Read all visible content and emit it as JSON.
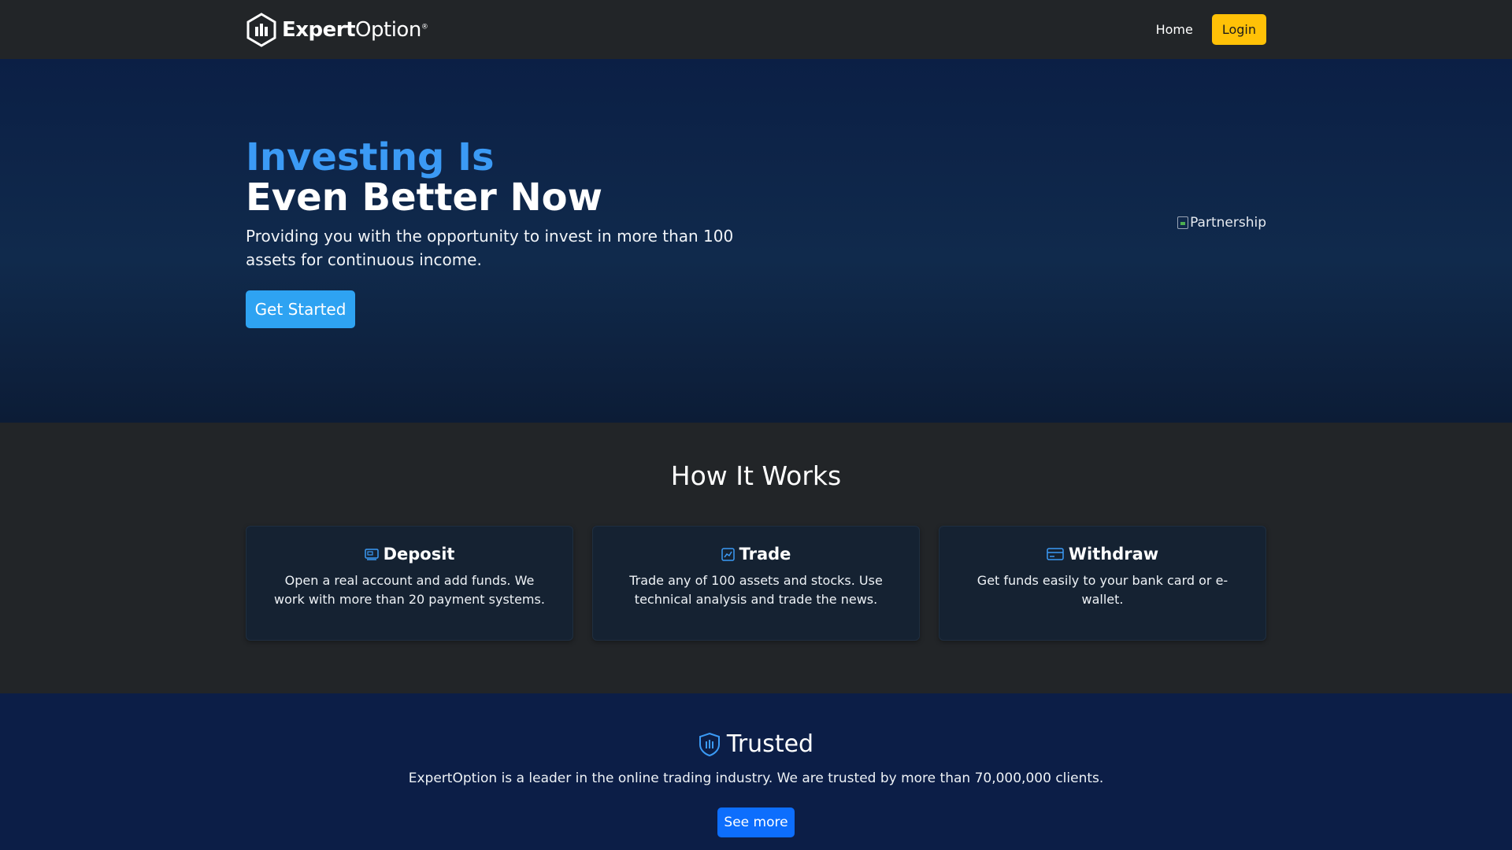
{
  "navbar": {
    "brand_bold": "Expert",
    "brand_regular": "Option",
    "brand_mark": "®",
    "home_label": "Home",
    "login_label": "Login"
  },
  "hero": {
    "title_line1": "Investing Is",
    "title_line2": "Even Better Now",
    "subtitle": "Providing you with the opportunity to invest in more than 100 assets for continuous income.",
    "cta_label": "Get Started",
    "partner_image_alt": "Partnership"
  },
  "how_it_works": {
    "title": "How It Works",
    "cards": [
      {
        "icon": "deposit-icon",
        "title": "Deposit",
        "text": "Open a real account and add funds. We work with more than 20 payment systems."
      },
      {
        "icon": "trade-chart-icon",
        "title": "Trade",
        "text": "Trade any of 100 assets and stocks. Use technical analysis and trade the news."
      },
      {
        "icon": "credit-card-icon",
        "title": "Withdraw",
        "text": "Get funds easily to your bank card or e-wallet."
      }
    ]
  },
  "trusted": {
    "icon": "shield-icon",
    "title": "Trusted",
    "text": "ExpertOption is a leader in the online trading industry. We are trusted by more than 70,000,000 clients.",
    "button_label": "See more"
  },
  "colors": {
    "accent_blue": "#3b9af5",
    "cta_blue": "#2ea3f2",
    "login_yellow": "#ffc107",
    "see_more_blue": "#0d6efd",
    "nav_bg": "#222528",
    "trusted_bg": "#0c1e47"
  }
}
